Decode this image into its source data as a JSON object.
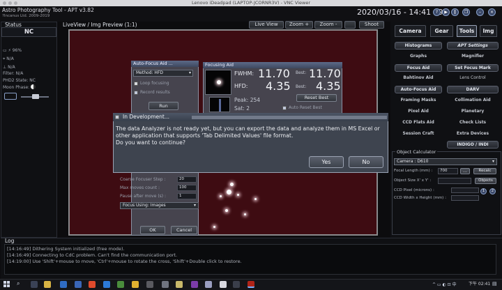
{
  "vnc": {
    "title": "Lenovo iDeadpad (LAPTOP-JCORNR3V) - VNC Viewer"
  },
  "app": {
    "title": "Astro Photography Tool  -  APT v3.82",
    "copyright": "?Incanus Ltd. 2009-2019",
    "clock": "2020/03/16 - 14:41 49"
  },
  "status": {
    "head": "Status",
    "value": "NC",
    "rows": [
      "96%",
      "N/A",
      "N/A"
    ],
    "filter": "Filter: N/A",
    "phd2": "PHD2 State: NC",
    "moon": "Moon Phase:"
  },
  "liveview": {
    "head": "LiveView / Img Preview (1:1)",
    "buttons": {
      "live_view": "Live View",
      "zoom_in": "Zoom +",
      "zoom_out": "Zoom -",
      "shoot": "Shoot"
    }
  },
  "tabs": [
    "Camera",
    "Gear",
    "Tools",
    "Img"
  ],
  "tools": {
    "left": [
      "Histograms",
      "Graphs",
      "Focus Aid",
      "Bahtinov Aid",
      "Auto-Focus Aid",
      "Framing Masks",
      "Pixel Aid",
      "CCD Flats Aid",
      "Session Craft"
    ],
    "right": [
      "APT Settings",
      "Magnifier",
      "Set Focus Mark",
      "Lens Control",
      "DARV",
      "Collimation Aid",
      "Planetary",
      "Check Lists",
      "Extra Devices",
      "INDIGO / INDI"
    ]
  },
  "objcalc": {
    "title": "Object Calculator",
    "camera": "Camera : D610",
    "focal_label": "Focal Length (mm) :",
    "focal_value": "700",
    "more": "...",
    "recalc": "Recalc",
    "objsize_label": "Object Size X' x Y' :",
    "objects": "Objects",
    "pixel_label": "CCD Pixel (microns) :",
    "wh_label": "CCD Width x Height (mm) :"
  },
  "af_dialog": {
    "title": "Auto-Focus Aid ...",
    "method": "Method: HFD",
    "loop": "Loop focusing",
    "record": "Record results",
    "run": "Run",
    "coarse": "Coarse Focuser Step :",
    "coarse_val": "20",
    "maxmoves": "Max moves count :",
    "maxmoves_val": "100",
    "pause": "Pause after move (s) :",
    "pause_val": "1",
    "using": "Focus Using: Images",
    "ok": "OK",
    "cancel": "Cancel"
  },
  "focusing": {
    "title": "Focusing Aid",
    "fwhm_label": "FWHM:",
    "fwhm": "11.70",
    "best_label": "Best:",
    "fwhm_best": "11.70",
    "hfd_label": "HFD:",
    "hfd": "4.35",
    "hfd_best": "4.35",
    "peak": "Peak: 254",
    "sat": "Sat:  2",
    "reset": "Reset Best",
    "auto_reset": "Auto Reset Best"
  },
  "dev_dialog": {
    "title": "In Development...",
    "message": "The data Analyzer is not ready yet, but you can export the data and analyze them in MS Excel or other application that supports 'Tab Delimited Values' file format.\nDo you want to continue?",
    "yes": "Yes",
    "no": "No"
  },
  "log": {
    "head": "Log",
    "lines": [
      "[14:16:49] Dithering System initialized (free mode).",
      "[14:16:49] Connecting to CdC problem. Can't find the communication port.",
      "[14:19:00] Use 'Shift'+mouse to move, 'Ctrl'+mouse to rotate the cross, 'Shift'+Double click to restore."
    ]
  },
  "taskbar": {
    "time": "下午 02:41"
  },
  "colors": {
    "image_bg": "#3e0c12",
    "accent": "#5c6a88"
  }
}
